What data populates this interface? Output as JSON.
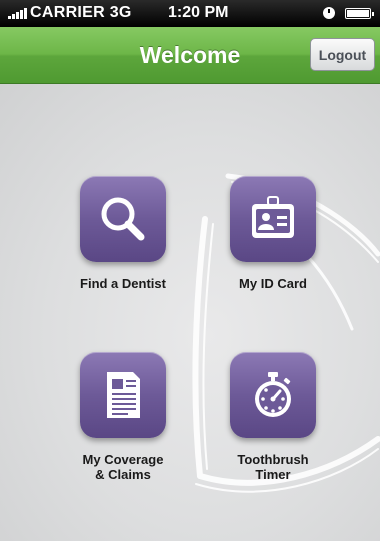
{
  "status_bar": {
    "carrier": "CARRIER 3G",
    "time": "1:20 PM"
  },
  "nav": {
    "title": "Welcome",
    "logout_label": "Logout"
  },
  "tiles": [
    {
      "label": "Find a Dentist",
      "icon": "magnifier-icon"
    },
    {
      "label": "My ID Card",
      "icon": "id-card-icon"
    },
    {
      "label_line1": "My Coverage",
      "label_line2": "& Claims",
      "icon": "document-icon"
    },
    {
      "label_line1": "Toothbrush",
      "label_line2": "Timer",
      "icon": "stopwatch-icon"
    }
  ],
  "colors": {
    "nav_green": "#6db648",
    "tile_purple": "#6d5a98",
    "background": "#dddedf"
  }
}
